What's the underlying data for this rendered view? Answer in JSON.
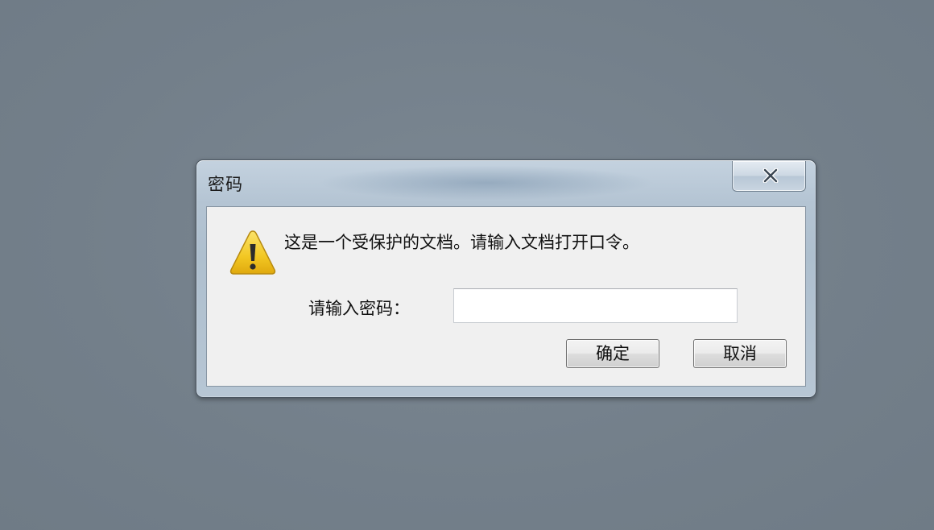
{
  "dialog": {
    "title": "密码",
    "message": "这是一个受保护的文档。请输入文档打开口令。",
    "password_label": "请输入密码：",
    "password_value": "",
    "ok_label": "确定",
    "cancel_label": "取消"
  },
  "icons": {
    "warning": "warning-icon",
    "close": "close-icon"
  },
  "colors": {
    "desktop_background": "#74808b",
    "warning_yellow": "#f2c722"
  }
}
